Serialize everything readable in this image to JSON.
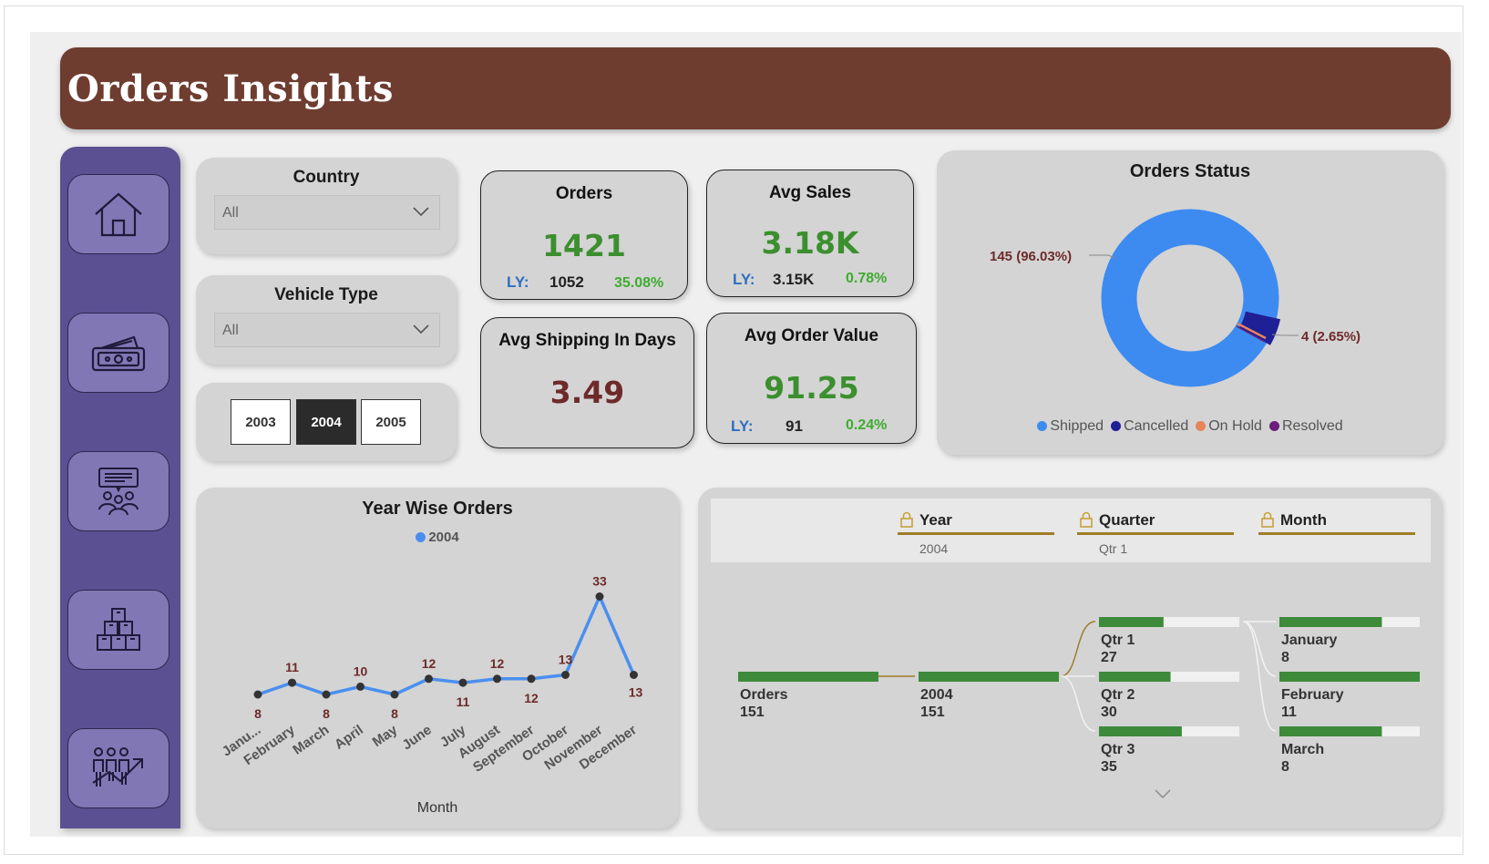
{
  "header": {
    "title": "Orders Insights"
  },
  "sidebar": {
    "items": [
      {
        "icon": "home-icon"
      },
      {
        "icon": "money-icon"
      },
      {
        "icon": "meeting-icon"
      },
      {
        "icon": "boxes-icon"
      },
      {
        "icon": "growth-icon"
      }
    ]
  },
  "filters": {
    "country": {
      "label": "Country",
      "value": "All"
    },
    "vehicle_type": {
      "label": "Vehicle Type",
      "value": "All"
    },
    "years": [
      "2003",
      "2004",
      "2005"
    ],
    "selected_year": "2004"
  },
  "kpis": {
    "orders": {
      "title": "Orders",
      "value": "1421",
      "ly_label": "LY:",
      "ly_value": "1052",
      "change": "35.08%"
    },
    "avg_sales": {
      "title": "Avg Sales",
      "value": "3.18K",
      "ly_label": "LY:",
      "ly_value": "3.15K",
      "change": "0.78%"
    },
    "avg_shipping": {
      "title": "Avg Shipping In Days",
      "value": "3.49"
    },
    "avg_order_value": {
      "title": "Avg Order Value",
      "value": "91.25",
      "ly_label": "LY:",
      "ly_value": "91",
      "change": "0.24%"
    }
  },
  "orders_status": {
    "title": "Orders Status",
    "label_major": "145 (96.03%)",
    "label_minor": "4 (2.65%)",
    "legend": [
      {
        "name": "Shipped",
        "color": "#3d8bf0"
      },
      {
        "name": "Cancelled",
        "color": "#1f1f96"
      },
      {
        "name": "On Hold",
        "color": "#e8845a"
      },
      {
        "name": "Resolved",
        "color": "#6b1f7a"
      }
    ]
  },
  "chart_data": {
    "type": "line",
    "title": "Year Wise Orders",
    "xlabel": "Month",
    "ylabel": "",
    "categories": [
      "Janu...",
      "February",
      "March",
      "April",
      "May",
      "June",
      "July",
      "August",
      "September",
      "October",
      "November",
      "December"
    ],
    "series": [
      {
        "name": "2004",
        "values": [
          8,
          11,
          8,
          10,
          8,
          12,
          11,
          12,
          12,
          13,
          33,
          13
        ],
        "color": "#4a8ff0"
      }
    ],
    "ylim": [
      0,
      36
    ],
    "grid": false,
    "legend": "top"
  },
  "decomposition": {
    "headers": [
      {
        "label": "Year",
        "sub": "2004"
      },
      {
        "label": "Quarter",
        "sub": "Qtr 1"
      },
      {
        "label": "Month",
        "sub": ""
      }
    ],
    "root": {
      "label": "Orders",
      "value": "151",
      "fill": 1.0
    },
    "year": {
      "label": "2004",
      "value": "151",
      "fill": 1.0
    },
    "quarters": [
      {
        "label": "Qtr 1",
        "value": "27",
        "fill": 0.46
      },
      {
        "label": "Qtr 2",
        "value": "30",
        "fill": 0.51
      },
      {
        "label": "Qtr 3",
        "value": "35",
        "fill": 0.59
      }
    ],
    "months": [
      {
        "label": "January",
        "value": "8",
        "fill": 0.73
      },
      {
        "label": "February",
        "value": "11",
        "fill": 1.0
      },
      {
        "label": "March",
        "value": "8",
        "fill": 0.73
      }
    ]
  }
}
